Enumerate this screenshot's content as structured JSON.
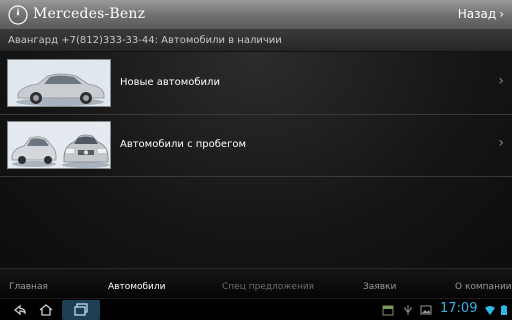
{
  "header": {
    "brand": "Mercedes-Benz",
    "back_label": "Назад",
    "back_chevron": "›"
  },
  "dealer": {
    "text": "Авангард +7(812)333-33-44: Автомобили в наличии"
  },
  "list": [
    {
      "label": "Новые автомобили",
      "chevron": "›"
    },
    {
      "label": "Автомобили с пробегом",
      "chevron": "›"
    }
  ],
  "nav": {
    "items": [
      {
        "label": "Главная"
      },
      {
        "label": "Автомобили"
      },
      {
        "label": "Спец предложения"
      },
      {
        "label": "Заявки"
      },
      {
        "label": "О компании"
      }
    ],
    "active_index": 1
  },
  "system": {
    "clock": "17:09"
  },
  "colors": {
    "accent": "#33b5e5",
    "header": "#7a7a7a"
  },
  "icons": {
    "logo": "mercedes-star-icon",
    "back_nav": "back-arrow-icon",
    "home": "home-icon",
    "recent": "recent-apps-icon"
  }
}
